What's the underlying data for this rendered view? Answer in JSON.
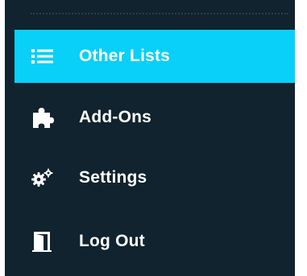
{
  "menu": {
    "items": [
      {
        "label": "Other Lists",
        "icon": "list-icon",
        "active": true
      },
      {
        "label": "Add-Ons",
        "icon": "puzzle-piece-icon",
        "active": false
      },
      {
        "label": "Settings",
        "icon": "gears-icon",
        "active": false
      },
      {
        "label": "Log Out",
        "icon": "door-exit-icon",
        "active": false
      }
    ]
  },
  "colors": {
    "menu_background": "#10232e",
    "active_background": "#08d0f8",
    "text": "#ffffff"
  }
}
